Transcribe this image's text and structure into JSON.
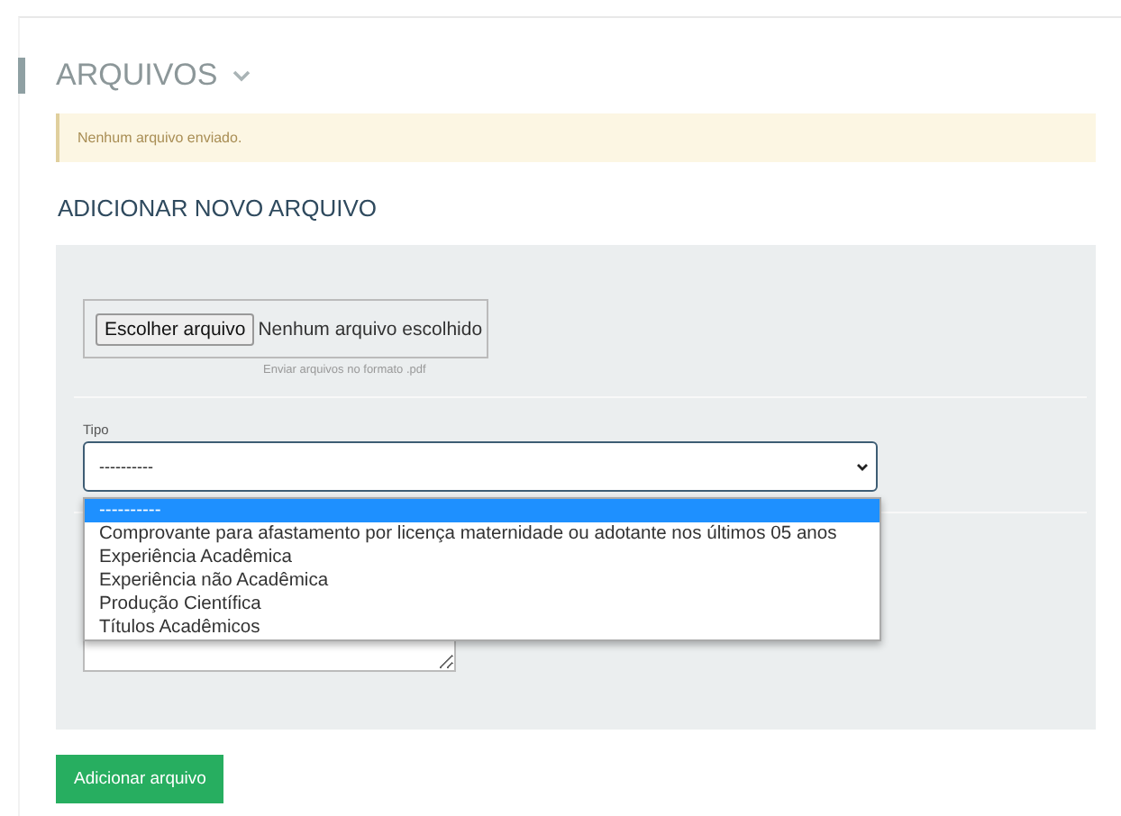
{
  "section": {
    "title": "ARQUIVOS"
  },
  "alert": {
    "text": "Nenhum arquivo enviado."
  },
  "form": {
    "title": "ADICIONAR NOVO ARQUIVO",
    "file_input": {
      "button": "Escolher arquivo",
      "status": "Nenhum arquivo escolhido",
      "hint": "Enviar arquivos no formato .pdf"
    },
    "type_select": {
      "label": "Tipo",
      "value": "----------",
      "expanded": true,
      "options": [
        {
          "label": "----------",
          "selected": true
        },
        {
          "label": "Comprovante para afastamento por licença maternidade ou adotante nos últimos 05 anos",
          "selected": false
        },
        {
          "label": "Experiência Acadêmica",
          "selected": false
        },
        {
          "label": "Experiência não Acadêmica",
          "selected": false
        },
        {
          "label": "Produção Científica",
          "selected": false
        },
        {
          "label": "Títulos Acadêmicos",
          "selected": false
        }
      ]
    }
  },
  "submit_button": "Adicionar arquivo"
}
